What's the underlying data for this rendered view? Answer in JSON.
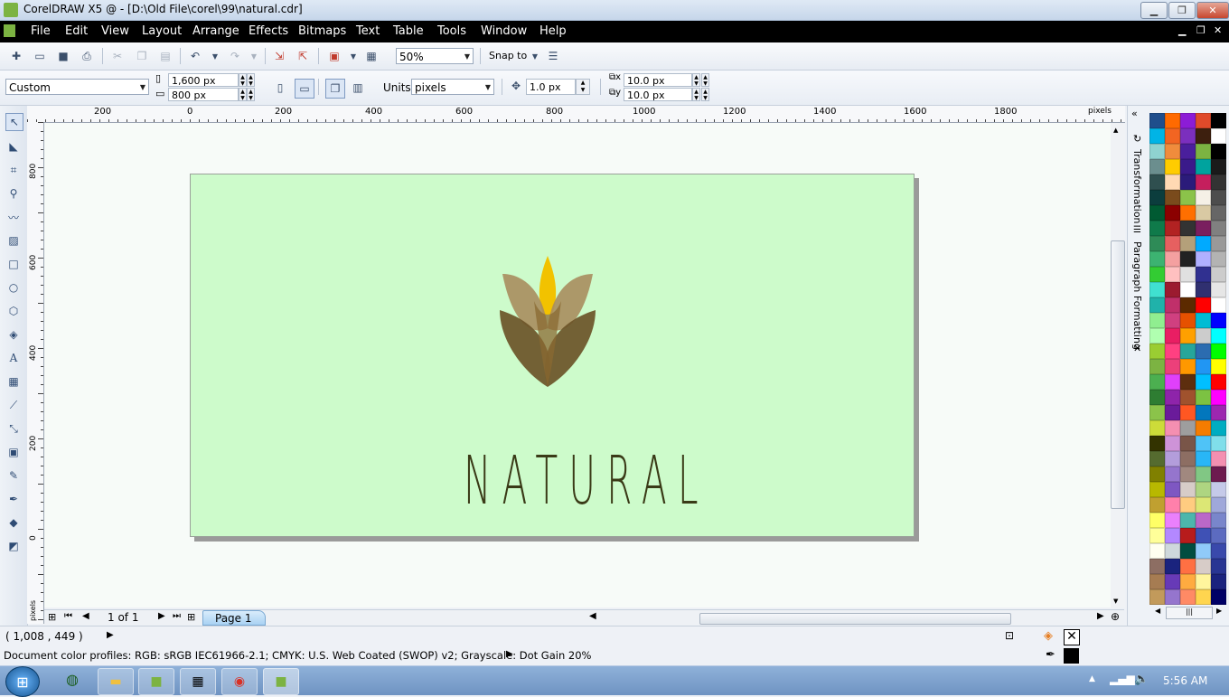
{
  "window": {
    "title": "CorelDRAW X5 @ - [D:\\Old File\\corel\\99\\natural.cdr]"
  },
  "menu": {
    "items": [
      "File",
      "Edit",
      "View",
      "Layout",
      "Arrange",
      "Effects",
      "Bitmaps",
      "Text",
      "Table",
      "Tools",
      "Window",
      "Help"
    ]
  },
  "toolbar": {
    "zoom_value": "50%",
    "snap_label": "Snap to"
  },
  "propbar": {
    "preset": "Custom",
    "width": "1,600 px",
    "height": "800 px",
    "units_label": "Units:",
    "units_value": "pixels",
    "nudge": "1.0 px",
    "dup_x": "10.0 px",
    "dup_y": "10.0 px"
  },
  "rulers": {
    "h_labels": [
      "200",
      "0",
      "200",
      "400",
      "600",
      "800",
      "1000",
      "1200",
      "1400",
      "1600",
      "1800",
      "pixels"
    ],
    "v_labels": [
      "800",
      "600",
      "400",
      "200",
      "0"
    ],
    "v_unit": "pixels"
  },
  "canvas": {
    "logo_text": "NATURAL"
  },
  "docker": {
    "tabs": [
      "Transformation",
      "Paragraph Formatting"
    ]
  },
  "pages": {
    "counter": "1 of 1",
    "tab": "Page 1"
  },
  "status": {
    "coords": "( 1,008 , 449   )",
    "color_profiles": "Document color profiles: RGB: sRGB IEC61966-2.1; CMYK: U.S. Web Coated (SWOP) v2; Grayscale: Dot Gain 20%"
  },
  "taskbar": {
    "clock": "5:56 AM"
  },
  "palette": {
    "colors": [
      "#1f4e8c",
      "#ff6a00",
      "#8c1cd6",
      "#e04a2a",
      "#000000",
      "#00b4e6",
      "#f26522",
      "#7b2fbe",
      "#3d1f0e",
      "#ffffff",
      "#8fd3d0",
      "#f08c3c",
      "#4a1f9c",
      "#7cb342",
      "#000000",
      "#6b8e8e",
      "#ffcc00",
      "#3a1a8a",
      "#00a39e",
      "#1a1a1a",
      "#2f4f4f",
      "#ffd9b3",
      "#2b1b7a",
      "#c51f5d",
      "#333333",
      "#0b3d3d",
      "#7a4b1c",
      "#8bc34a",
      "#f5f0e6",
      "#4d4d4d",
      "#005a32",
      "#8b0000",
      "#ff6f00",
      "#d9c9a3",
      "#666666",
      "#0f7a4a",
      "#b22222",
      "#333333",
      "#7a1f5f",
      "#808080",
      "#2e8b57",
      "#e66060",
      "#b4a07a",
      "#00aaff",
      "#999999",
      "#3cb371",
      "#f4a0a0",
      "#222222",
      "#b0b0ff",
      "#b3b3b3",
      "#33cc33",
      "#ffc0c0",
      "#e0e0e0",
      "#303090",
      "#cccccc",
      "#40e0d0",
      "#9b1b30",
      "#ffffff",
      "#303070",
      "#e6e6e6",
      "#20b2aa",
      "#c0306a",
      "#5c2a00",
      "#ff0000",
      "#ffffff",
      "#90ee90",
      "#d04080",
      "#e65100",
      "#00bcd4",
      "#0000ff",
      "#b0ffb0",
      "#e91e63",
      "#ffa000",
      "#cccccc",
      "#00ffff",
      "#9acd32",
      "#ff4081",
      "#26a69a",
      "#2b6cb0",
      "#00ff00",
      "#7cb342",
      "#ec407a",
      "#ff9800",
      "#2196f3",
      "#ffff00",
      "#4caf50",
      "#e040fb",
      "#5d2e0e",
      "#00bfff",
      "#ff0000",
      "#2e7d32",
      "#8e24aa",
      "#a0522d",
      "#7cc242",
      "#ff00ff",
      "#8bc34a",
      "#6a1b9a",
      "#ff5722",
      "#0277bd",
      "#9c27b0",
      "#cddc39",
      "#f48fb1",
      "#9e9e9e",
      "#f57c00",
      "#00acc1",
      "#333300",
      "#ce93d8",
      "#795548",
      "#4fc3f7",
      "#80deea",
      "#556b2f",
      "#b39ddb",
      "#8d6e63",
      "#29b6f6",
      "#f48fb1",
      "#808000",
      "#9575cd",
      "#a1887f",
      "#81c784",
      "#6d1b4f",
      "#b8b800",
      "#7e57c2",
      "#d7ccc8",
      "#aed581",
      "#c5cae9",
      "#c0a030",
      "#ff80ab",
      "#ffcc80",
      "#dce775",
      "#9fa8da",
      "#ffff66",
      "#ea80fc",
      "#4db6ac",
      "#ba68c8",
      "#7986cb",
      "#ffff99",
      "#b388ff",
      "#b71c1c",
      "#3f51b5",
      "#5c6bc0",
      "#fffff0",
      "#cfd8dc",
      "#004d40",
      "#90caf9",
      "#3949ab",
      "#8d6e63",
      "#1a237e",
      "#ff7043",
      "#d7ccc8",
      "#283593",
      "#a67c52",
      "#673ab7",
      "#ffab40",
      "#fff59d",
      "#1a237e",
      "#c29a5b",
      "#9575cd",
      "#ff8a65",
      "#ffd54f",
      "#000066"
    ],
    "special": {
      "no_color": "none",
      "selected": "#ffffff"
    }
  },
  "colors": {
    "page_fill": "#cdfbcb",
    "logo_text": "#3a3a17",
    "petal_dark": "#6b5428",
    "petal_light": "#a88d5e",
    "petal_center": "#f2c200"
  }
}
